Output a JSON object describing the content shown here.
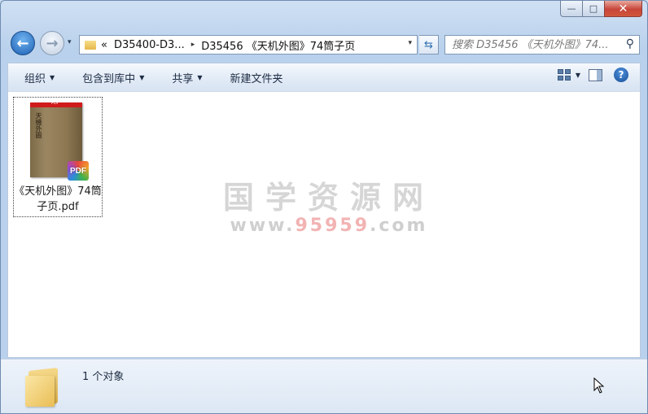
{
  "window": {
    "caption": {
      "minimize": "—",
      "maximize": "□",
      "close": "✕"
    }
  },
  "nav": {
    "back_icon": "back-arrow-icon",
    "forward_icon": "forward-arrow-icon",
    "recent_glyph": "▾",
    "address": {
      "overflow": "«",
      "crumbs": [
        "D35400-D3...",
        "D35456 《天机外图》74筒子页"
      ],
      "separator": "▸",
      "dropdown": "▾"
    },
    "refresh_glyph": "⇆",
    "search": {
      "placeholder": "搜索 D35456 《天机外图》74...",
      "icon": "magnifier-icon"
    }
  },
  "toolbar": {
    "organize": "组织",
    "include_library": "包含到库中",
    "share": "共享",
    "new_folder": "新建文件夹",
    "dropdown_glyph": "▼",
    "help": "?"
  },
  "files": [
    {
      "name": "《天机外图》74筒子页.pdf",
      "thumb_banner": "PDF",
      "thumb_chars": "天機外圖",
      "badge": "PDF"
    }
  ],
  "watermark": {
    "title": "国学资源网",
    "url_prefix": "www.",
    "url_red": "95959",
    "url_suffix": ".com"
  },
  "status": {
    "count_text": "1 个对象"
  },
  "colors": {
    "accent": "#1d5fb3",
    "close_red": "#c8453a",
    "pdf_red": "#d01b1b"
  }
}
